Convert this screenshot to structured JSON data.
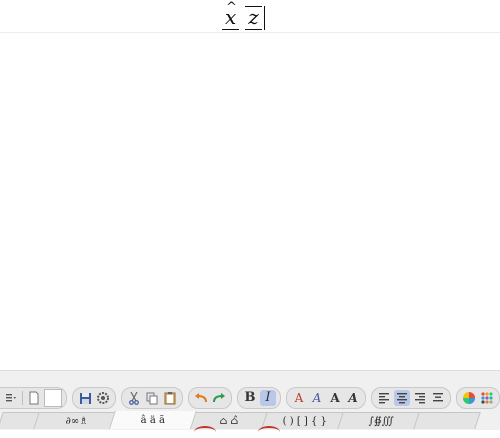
{
  "formula": {
    "term1_base": "x",
    "term1_accent": "^",
    "term2_base": "z"
  },
  "toolbar": {
    "groups": [
      {
        "name": "list-group",
        "items": [
          "list-style-icon",
          "new-doc-icon",
          "blank-field"
        ]
      },
      {
        "name": "file-group",
        "items": [
          "save-icon",
          "settings-icon"
        ]
      },
      {
        "name": "clipboard-group",
        "items": [
          "cut-icon",
          "copy-icon",
          "paste-icon"
        ]
      },
      {
        "name": "history-group",
        "items": [
          "undo-icon",
          "redo-icon"
        ]
      },
      {
        "name": "style-group",
        "bold": "B",
        "italic": "I"
      },
      {
        "name": "font-group",
        "letters": [
          "A",
          "A",
          "A",
          "A"
        ]
      },
      {
        "name": "align-group",
        "items": [
          "align-left-icon",
          "align-center-icon",
          "align-right-icon",
          "align-justify-icon"
        ]
      },
      {
        "name": "color-group",
        "items": [
          "color-wheel-icon",
          "palette-icon"
        ]
      },
      {
        "name": "play-group",
        "items": [
          "play-icon",
          "matrix-icon"
        ]
      }
    ]
  },
  "tabs": [
    {
      "label": ""
    },
    {
      "label": "∂∞♗"
    },
    {
      "label": "â ä ã"
    },
    {
      "label": "⌂ ⌂̂"
    },
    {
      "label": "( ) [ ] { }"
    },
    {
      "label": "∫∯∭"
    },
    {
      "label": ""
    }
  ],
  "colors": {
    "toolbar_bg": "#f0f0f0",
    "group_bg": "#e6e6e6",
    "active_button": "#b9c7e8",
    "undo_color": "#e07a1f",
    "redo_color": "#2e9b4a",
    "annotation_red": "#c0392b"
  }
}
